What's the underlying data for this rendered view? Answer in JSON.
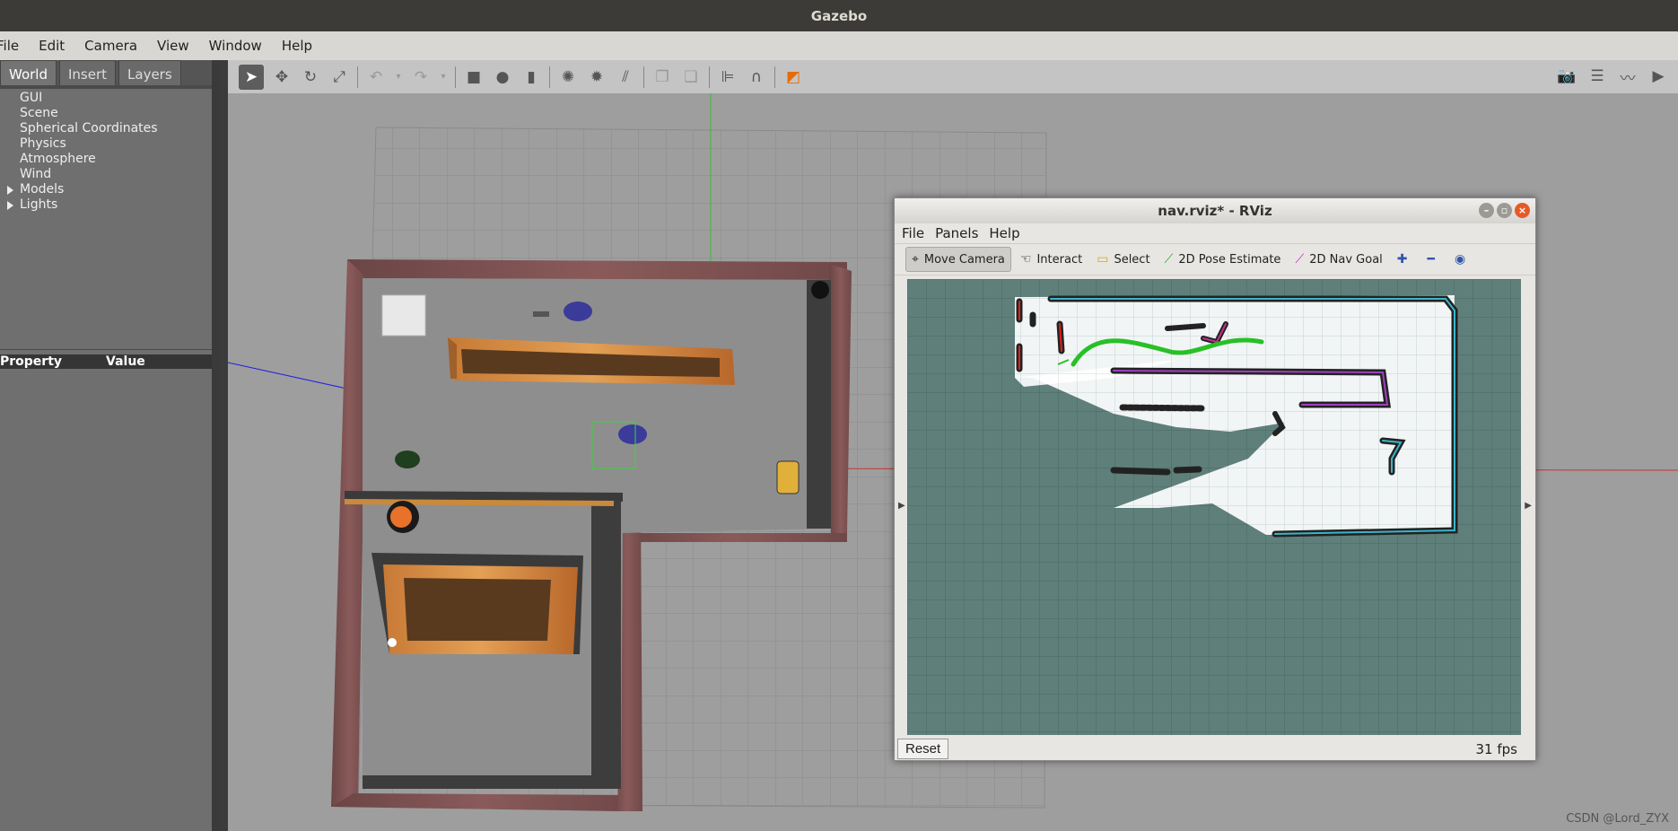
{
  "window": {
    "title": "Gazebo"
  },
  "menu": [
    "File",
    "Edit",
    "Camera",
    "View",
    "Window",
    "Help"
  ],
  "left_panel": {
    "tabs": [
      "World",
      "Insert",
      "Layers"
    ],
    "tree": [
      {
        "label": "GUI",
        "expandable": false
      },
      {
        "label": "Scene",
        "expandable": false
      },
      {
        "label": "Spherical Coordinates",
        "expandable": false
      },
      {
        "label": "Physics",
        "expandable": false
      },
      {
        "label": "Atmosphere",
        "expandable": false
      },
      {
        "label": "Wind",
        "expandable": false
      },
      {
        "label": "Models",
        "expandable": true
      },
      {
        "label": "Lights",
        "expandable": true
      }
    ],
    "property_header": {
      "property": "Property",
      "value": "Value"
    }
  },
  "toolbar_icons": [
    "select-icon",
    "translate-icon",
    "rotate-icon",
    "scale-icon",
    "undo-icon",
    "undo-menu-icon",
    "redo-icon",
    "redo-menu-icon",
    "box-icon",
    "sphere-icon",
    "cylinder-icon",
    "point-light-icon",
    "spot-light-icon",
    "directional-light-icon",
    "copy-icon",
    "paste-icon",
    "align-icon",
    "snap-icon",
    "view-angle-icon",
    "screenshot-icon",
    "log-icon",
    "plot-icon",
    "video-icon"
  ],
  "rviz": {
    "title": "nav.rviz* - RViz",
    "menu": [
      "File",
      "Panels",
      "Help"
    ],
    "tools": [
      "Move Camera",
      "Interact",
      "Select",
      "2D Pose Estimate",
      "2D Nav Goal"
    ],
    "reset_label": "Reset",
    "fps": "31 fps"
  },
  "watermark": "CSDN @Lord_ZYX"
}
